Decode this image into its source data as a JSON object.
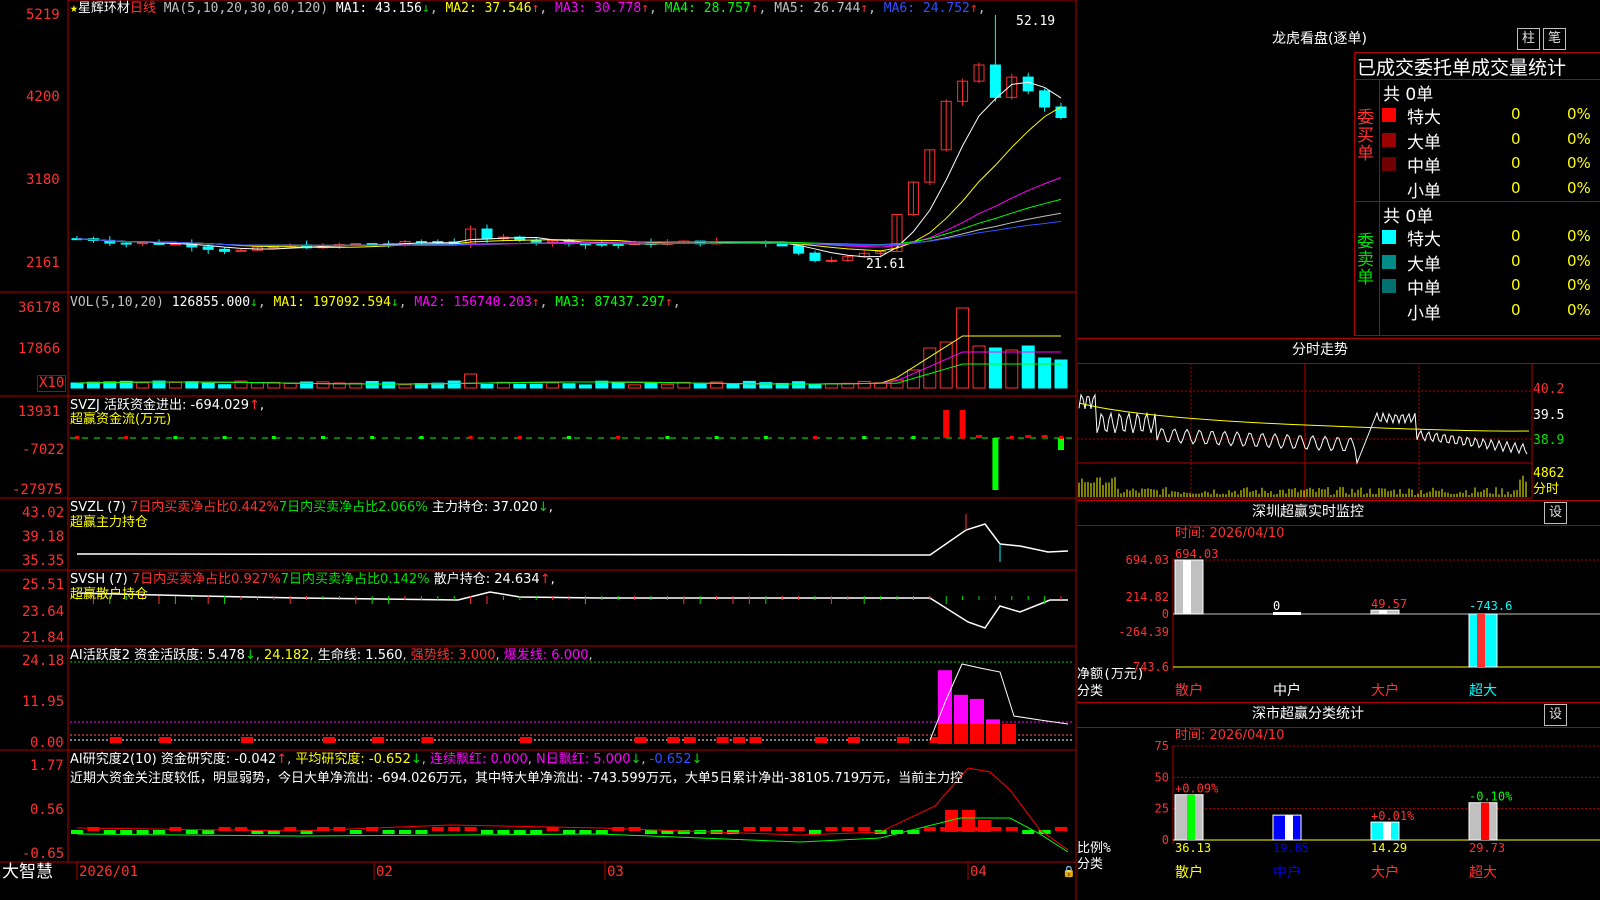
{
  "stock": {
    "name": "星辉环材",
    "period": "日线",
    "star": "★"
  },
  "colors": {
    "up": "#ff3030",
    "down": "#00ffff",
    "grid": "#b00000",
    "ma1": "#ffffff",
    "ma2": "#ffff00",
    "ma3": "#ff00ff",
    "ma4": "#00ff00",
    "ma5": "#c0c0c0",
    "ma6": "#3050ff"
  },
  "main": {
    "legend": {
      "prefix": "MA(5,10,20,30,60,120)",
      "items": [
        {
          "label": "MA1: 43.156",
          "arrow": "↓",
          "color": "#ffffff"
        },
        {
          "label": "MA2: 37.546",
          "arrow": "↑",
          "color": "#ffff00"
        },
        {
          "label": "MA3: 30.778",
          "arrow": "↑",
          "color": "#ff00ff"
        },
        {
          "label": "MA4: 28.757",
          "arrow": "↑",
          "color": "#00ff00"
        },
        {
          "label": "MA5: 26.744",
          "arrow": "↑",
          "color": "#c0c0c0"
        },
        {
          "label": "MA6: 24.752",
          "arrow": "↑",
          "color": "#3050ff"
        }
      ]
    },
    "yticks": [
      "5219",
      "4200",
      "3180",
      "2161"
    ],
    "high_label": "52.19",
    "low_label": "21.61"
  },
  "vol": {
    "prefix": "VOL(5,10,20)",
    "value": "126855.000",
    "arrow": "↓",
    "ma": [
      {
        "label": "MA1: 197092.594",
        "arrow": "↓",
        "color": "#ffff00"
      },
      {
        "label": "MA2: 156740.203",
        "arrow": "↑",
        "color": "#ff00ff"
      },
      {
        "label": "MA3: 87437.297",
        "arrow": "↑",
        "color": "#00ff00"
      }
    ],
    "yticks": [
      "36178",
      "17866"
    ],
    "unit": "X10"
  },
  "svzj": {
    "title": "SVZJ  活跃资金进出: -694.029",
    "arrow": "↑",
    "suffix": ",",
    "sub": "超赢资金流(万元)",
    "yticks": [
      "13931",
      "-7022",
      "-27975"
    ]
  },
  "svzl": {
    "title": "SVZL (7)",
    "red_text": "7日内买卖净占比0.442%",
    "grn_text": "7日内买卖净占比2.066%",
    "white_text": "主力持仓: 37.020",
    "arrow": "↓",
    "suffix": ",",
    "sub": "超赢主力持仓",
    "yticks": [
      "43.02",
      "39.18",
      "35.35"
    ]
  },
  "svsh": {
    "title": "SVSH (7)",
    "red_text": "7日内买卖净占比0.927%",
    "grn_text": "7日内买卖净占比0.142%",
    "white_text": "散户持仓: 24.634",
    "arrow": "↑",
    "suffix": ",",
    "sub": "超赢散户持仓",
    "yticks": [
      "25.51",
      "23.64",
      "21.84"
    ]
  },
  "ai1": {
    "title": "AI活跃度2 资金活跃度: 5.478",
    "arrow": "↓",
    "v2": "24.182",
    "life": "生命线: 1.560",
    "strong": "强势线: 3.000",
    "burst": "爆发线: 6.000",
    "yticks": [
      "24.18",
      "11.95",
      "0.00"
    ]
  },
  "ai2": {
    "title": "AI研究度2(10) 资金研究度: -0.042",
    "arrow": "↑",
    "avg": "平均研究度: -0.652",
    "avg_arrow": "↓",
    "red1": "连续飘红: 0.000",
    "red2": "N日飘红: 5.000",
    "red2_arrow": "↓",
    "last": "-0.652",
    "last_arrow": "↓",
    "comment": "近期大资金关注度较低，明显弱势，今日大单净流出: -694.026万元，其中特大单净流出: -743.599万元，大单5日累计净出-38105.719万元，当前主力控",
    "yticks": [
      "1.77",
      "0.56",
      "-0.65"
    ]
  },
  "xaxis": {
    "labels": [
      "2026/01",
      "02",
      "03",
      "04"
    ],
    "brand": "大智慧"
  },
  "right": {
    "title": "龙虎看盘(逐单)",
    "btn1": "柱",
    "btn2": "笔",
    "stat_title": "已成交委托单成交量统计",
    "buy": {
      "side": "委买单",
      "total": "共 0单",
      "rows": [
        {
          "name": "特大",
          "val": "0",
          "pct": "0%",
          "color": "#ff0000"
        },
        {
          "name": "大单",
          "val": "0",
          "pct": "0%",
          "color": "#9a0000"
        },
        {
          "name": "中单",
          "val": "0",
          "pct": "0%",
          "color": "#700000"
        },
        {
          "name": "小单",
          "val": "0",
          "pct": "0%",
          "color": ""
        }
      ]
    },
    "sell": {
      "side": "委卖单",
      "total": "共 0单",
      "rows": [
        {
          "name": "特大",
          "val": "0",
          "pct": "0%",
          "color": "#00ffff"
        },
        {
          "name": "大单",
          "val": "0",
          "pct": "0%",
          "color": "#008b8b"
        },
        {
          "name": "中单",
          "val": "0",
          "pct": "0%",
          "color": "#007070"
        },
        {
          "name": "小单",
          "val": "0",
          "pct": "0%",
          "color": ""
        }
      ]
    },
    "intraday": {
      "title": "分时走势",
      "yticks": [
        "40.2",
        "39.5",
        "38.9"
      ],
      "vol_tick": "4862",
      "vol_unit": "分时"
    },
    "monitor": {
      "title": "深圳超赢实时监控",
      "btn": "设",
      "time": "时间: 2026/04/10",
      "yticks": [
        "694.03",
        "214.82",
        "0",
        "-264.39",
        "-743.6"
      ],
      "bars": [
        {
          "cat": "散户",
          "value": 694.03,
          "label": "694.03"
        },
        {
          "cat": "中户",
          "value": 0,
          "label": "0"
        },
        {
          "cat": "大户",
          "value": 49.57,
          "label": "49.57"
        },
        {
          "cat": "超大",
          "value": -743.6,
          "label": "-743.6"
        }
      ],
      "ylabel": "净额(万元)",
      "xlabel": "分类"
    },
    "classify": {
      "title": "深市超赢分类统计",
      "btn": "设",
      "time": "时间: 2026/04/10",
      "yticks": [
        "75",
        "50",
        "25",
        "0"
      ],
      "bars": [
        {
          "cat": "散户",
          "value": 36.13,
          "chg": "+0.09%"
        },
        {
          "cat": "中户",
          "value": 19.85,
          "chg": ""
        },
        {
          "cat": "大户",
          "value": 14.29,
          "chg": "+0.01%"
        },
        {
          "cat": "超大",
          "value": 29.73,
          "chg": "-0.10%"
        }
      ],
      "ylabel": "比例%",
      "xlabel": "分类"
    }
  },
  "chart_data": [
    {
      "type": "candlestick",
      "title": "星辉环材 日线",
      "x": [
        "2026/01",
        "02",
        "03",
        "04"
      ],
      "ylim": [
        21.61,
        52.19
      ],
      "ytick_labels": [
        "5219",
        "4200",
        "3180",
        "2161"
      ],
      "series": [
        {
          "name": "MA1",
          "value": 43.156
        },
        {
          "name": "MA2",
          "value": 37.546
        },
        {
          "name": "MA3",
          "value": 30.778
        },
        {
          "name": "MA4",
          "value": 28.757
        },
        {
          "name": "MA5",
          "value": 26.744
        },
        {
          "name": "MA6",
          "value": 24.752
        }
      ],
      "annotations": [
        "52.19",
        "21.61"
      ]
    },
    {
      "type": "bar",
      "title": "VOL(5,10,20)",
      "value": 126855.0,
      "series": [
        {
          "name": "MA1",
          "value": 197092.594
        },
        {
          "name": "MA2",
          "value": 156740.203
        },
        {
          "name": "MA3",
          "value": 87437.297
        }
      ],
      "ylim": [
        0,
        36178
      ]
    },
    {
      "type": "bar",
      "title": "深圳超赢实时监控",
      "categories": [
        "散户",
        "中户",
        "大户",
        "超大"
      ],
      "values": [
        694.03,
        0,
        49.57,
        -743.6
      ],
      "ylabel": "净额(万元)",
      "xlabel": "分类",
      "ylim": [
        -743.6,
        694.03
      ]
    },
    {
      "type": "bar",
      "title": "深市超赢分类统计",
      "categories": [
        "散户",
        "中户",
        "大户",
        "超大"
      ],
      "values": [
        36.13,
        19.85,
        14.29,
        29.73
      ],
      "ylabel": "比例%",
      "xlabel": "分类",
      "ylim": [
        0,
        75
      ]
    }
  ]
}
